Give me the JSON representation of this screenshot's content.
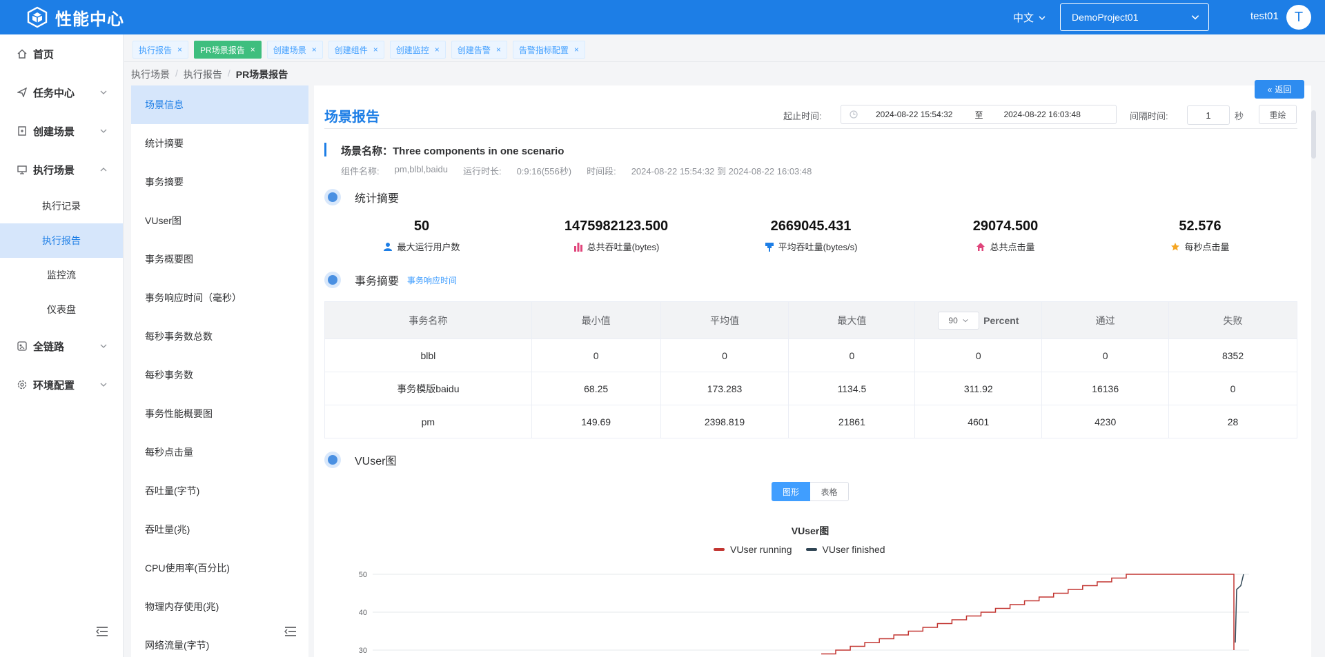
{
  "header": {
    "title": "性能中心",
    "lang": "中文",
    "project": "DemoProject01",
    "user": "test01",
    "avatar_letter": "T",
    "brand_color": "#1d7ee6"
  },
  "sidebar": {
    "items": [
      {
        "label": "首页",
        "icon": "home-icon"
      },
      {
        "label": "任务中心",
        "icon": "send-icon"
      },
      {
        "label": "创建场景",
        "icon": "document-icon"
      },
      {
        "label": "执行场景",
        "icon": "monitor-icon"
      },
      {
        "label": "全链路",
        "icon": "link-icon"
      },
      {
        "label": "环境配置",
        "icon": "gear-icon"
      }
    ],
    "sub_items": [
      "执行记录",
      "执行报告",
      "监控流",
      "仪表盘"
    ]
  },
  "tabs": [
    "执行报告",
    "PR场景报告",
    "创建场景",
    "创建组件",
    "创建监控",
    "创建告警",
    "告警指标配置"
  ],
  "breadcrumb": [
    "执行场景",
    "执行报告",
    "PR场景报告"
  ],
  "secnav": [
    "场景信息",
    "统计摘要",
    "事务摘要",
    "VUser图",
    "事务概要图",
    "事务响应时间（毫秒）",
    "每秒事务数总数",
    "每秒事务数",
    "事务性能概要图",
    "每秒点击量",
    "吞吐量(字节)",
    "吞吐量(兆)",
    "CPU使用率(百分比)",
    "物理内存使用(兆)",
    "网络流量(字节)"
  ],
  "report": {
    "title": "场景报告",
    "back": "返回",
    "time_label": "起止时间:",
    "start": "2024-08-22 15:54:32",
    "to": "至",
    "end": "2024-08-22 16:03:48",
    "interval_label": "间隔时间:",
    "interval": "1",
    "sec": "秒",
    "redraw": "重绘",
    "scene_name": "场景名称：Three components in one scenario",
    "meta": {
      "comp_k": "组件名称:",
      "comp_v": "pm,blbl,baidu",
      "dur_k": "运行时长:",
      "dur_v": "0:9:16(556秒)",
      "period_k": "时间段:",
      "period_v": "2024-08-22 15:54:32 到 2024-08-22 16:03:48"
    }
  },
  "stats_section": {
    "title": "统计摘要",
    "items": [
      {
        "num": "50",
        "label": "最大运行用户数",
        "icon": "user-icon",
        "color": "#1d7ee6"
      },
      {
        "num": "1475982123.500",
        "label": "总共吞吐量(bytes)",
        "icon": "bar-chart-icon",
        "color": "#e0457b"
      },
      {
        "num": "2669045.431",
        "label": "平均吞吐量(bytes/s)",
        "icon": "pin-icon",
        "color": "#1d7ee6"
      },
      {
        "num": "29074.500",
        "label": "总共点击量",
        "icon": "house-icon",
        "color": "#e0457b"
      },
      {
        "num": "52.576",
        "label": "每秒点击量",
        "icon": "star-icon",
        "color": "#f5a623"
      }
    ]
  },
  "txn_section": {
    "title": "事务摘要",
    "link": "事务响应时间",
    "headers": [
      "事务名称",
      "最小值",
      "平均值",
      "最大值",
      "Percent",
      "通过",
      "失败"
    ],
    "percent_select": "90",
    "rows": [
      [
        "blbl",
        "0",
        "0",
        "0",
        "0",
        "0",
        "8352"
      ],
      [
        "事务模版baidu",
        "68.25",
        "173.283",
        "1134.5",
        "311.92",
        "16136",
        "0"
      ],
      [
        "pm",
        "149.69",
        "2398.819",
        "21861",
        "4601",
        "4230",
        "28"
      ]
    ]
  },
  "vuser_section": {
    "title": "VUser图",
    "toggle_on": "图形",
    "toggle_off": "表格"
  },
  "chart_data": {
    "type": "line",
    "title": "VUser图",
    "series": [
      {
        "name": "VUser running",
        "color": "#c23531"
      },
      {
        "name": "VUser finished",
        "color": "#2f4554"
      }
    ],
    "yticks": [
      50,
      40,
      30
    ],
    "ylim": [
      30,
      50
    ],
    "grid": true,
    "legend": "top"
  }
}
